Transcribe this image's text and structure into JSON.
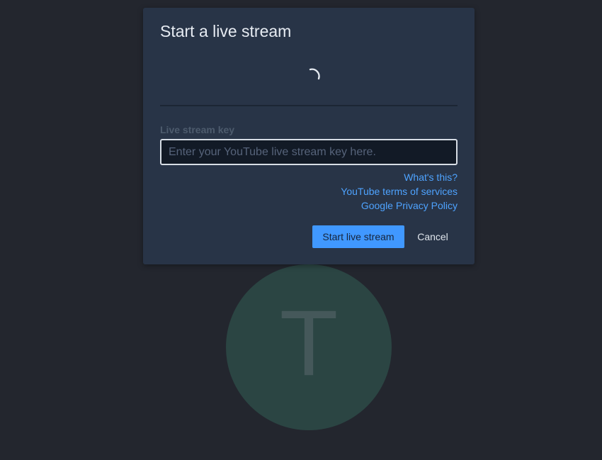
{
  "avatar": {
    "letter": "T",
    "color": "#2b4543"
  },
  "dialog": {
    "title": "Start a live stream",
    "loading_icon": "spinner-icon",
    "stream_key": {
      "label": "Live stream key",
      "value": "",
      "placeholder": "Enter your YouTube live stream key here."
    },
    "links": [
      {
        "label": "What's this?"
      },
      {
        "label": "YouTube terms of services"
      },
      {
        "label": "Google Privacy Policy"
      }
    ],
    "buttons": {
      "start_label": "Start live stream",
      "cancel_label": "Cancel"
    }
  },
  "colors": {
    "background": "#23262e",
    "dialog": "#283447",
    "accent": "#4098ff",
    "link": "#4ea3ff"
  }
}
